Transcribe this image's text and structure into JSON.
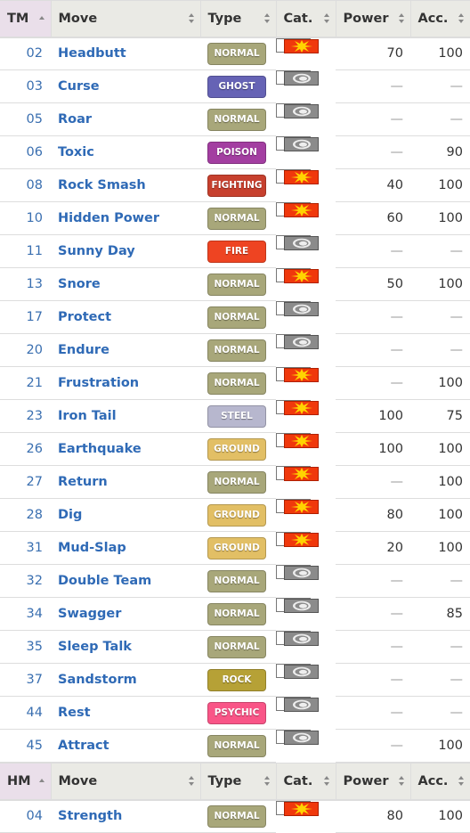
{
  "colors": {
    "NORMAL": "#a8a77a",
    "GHOST": "#6663b5",
    "POISON": "#a33ea1",
    "FIGHTING": "#c7402e",
    "FIRE": "#ee4422",
    "STEEL": "#b7b7ce",
    "GROUND": "#e2bf65",
    "ROCK": "#b6a136",
    "PSYCHIC": "#f95587"
  },
  "tm_table": {
    "headers": [
      "TM",
      "Move",
      "Type",
      "Cat.",
      "Power",
      "Acc."
    ],
    "rows": [
      [
        "02",
        "Headbutt",
        "NORMAL",
        "physical",
        "70",
        "100"
      ],
      [
        "03",
        "Curse",
        "GHOST",
        "status",
        "—",
        "—"
      ],
      [
        "05",
        "Roar",
        "NORMAL",
        "status",
        "—",
        "—"
      ],
      [
        "06",
        "Toxic",
        "POISON",
        "status",
        "—",
        "90"
      ],
      [
        "08",
        "Rock Smash",
        "FIGHTING",
        "physical",
        "40",
        "100"
      ],
      [
        "10",
        "Hidden Power",
        "NORMAL",
        "physical",
        "60",
        "100"
      ],
      [
        "11",
        "Sunny Day",
        "FIRE",
        "status",
        "—",
        "—"
      ],
      [
        "13",
        "Snore",
        "NORMAL",
        "physical",
        "50",
        "100"
      ],
      [
        "17",
        "Protect",
        "NORMAL",
        "status",
        "—",
        "—"
      ],
      [
        "20",
        "Endure",
        "NORMAL",
        "status",
        "—",
        "—"
      ],
      [
        "21",
        "Frustration",
        "NORMAL",
        "physical",
        "—",
        "100"
      ],
      [
        "23",
        "Iron Tail",
        "STEEL",
        "physical",
        "100",
        "75"
      ],
      [
        "26",
        "Earthquake",
        "GROUND",
        "physical",
        "100",
        "100"
      ],
      [
        "27",
        "Return",
        "NORMAL",
        "physical",
        "—",
        "100"
      ],
      [
        "28",
        "Dig",
        "GROUND",
        "physical",
        "80",
        "100"
      ],
      [
        "31",
        "Mud-Slap",
        "GROUND",
        "physical",
        "20",
        "100"
      ],
      [
        "32",
        "Double Team",
        "NORMAL",
        "status",
        "—",
        "—"
      ],
      [
        "34",
        "Swagger",
        "NORMAL",
        "status",
        "—",
        "85"
      ],
      [
        "35",
        "Sleep Talk",
        "NORMAL",
        "status",
        "—",
        "—"
      ],
      [
        "37",
        "Sandstorm",
        "ROCK",
        "status",
        "—",
        "—"
      ],
      [
        "44",
        "Rest",
        "PSYCHIC",
        "status",
        "—",
        "—"
      ],
      [
        "45",
        "Attract",
        "NORMAL",
        "status",
        "—",
        "100"
      ]
    ]
  },
  "hm_table": {
    "headers": [
      "HM",
      "Move",
      "Type",
      "Cat.",
      "Power",
      "Acc."
    ],
    "rows": [
      [
        "04",
        "Strength",
        "NORMAL",
        "physical",
        "80",
        "100"
      ]
    ]
  }
}
